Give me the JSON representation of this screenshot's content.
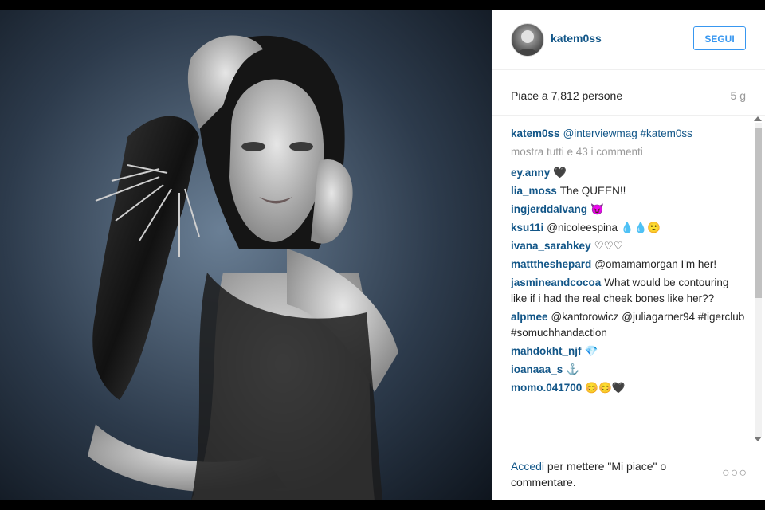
{
  "post": {
    "username": "katem0ss",
    "follow_label": "SEGUI",
    "likes_text": "Piace a 7,812 persone",
    "age": "5 g",
    "caption_user": "katem0ss",
    "caption_text": "@interviewmag #katem0ss",
    "more_comments": "mostra tutti e 43 i commenti"
  },
  "comments": [
    {
      "user": "ey.anny",
      "text": "🖤"
    },
    {
      "user": "lia_moss",
      "text": "The QUEEN!!"
    },
    {
      "user": "ingjerddalvang",
      "text": "😈"
    },
    {
      "user": "ksu11i",
      "text": "@nicoleespina 💧💧🙁"
    },
    {
      "user": "ivana_sarahkey",
      "text": "♡♡♡"
    },
    {
      "user": "matttheshepard",
      "text": "@omamamorgan I'm her!"
    },
    {
      "user": "jasmineandcocoa",
      "text": "What would be contouring like if i had the real cheek bones like her??"
    },
    {
      "user": "alpmee",
      "text": "@kantorowicz @juliagarner94 #tigerclub #somuchhandaction"
    },
    {
      "user": "mahdokht_njf",
      "text": "💎"
    },
    {
      "user": "ioanaaa_s",
      "text": "⚓"
    },
    {
      "user": "momo.041700",
      "text": "😊😊🖤"
    }
  ],
  "footer": {
    "login_link": "Accedi",
    "login_text": " per mettere \"Mi piace\" o commentare.",
    "more_icon": "ellipsis-icon"
  },
  "colors": {
    "link": "#125688",
    "button": "#3897f0",
    "muted": "#999999"
  }
}
